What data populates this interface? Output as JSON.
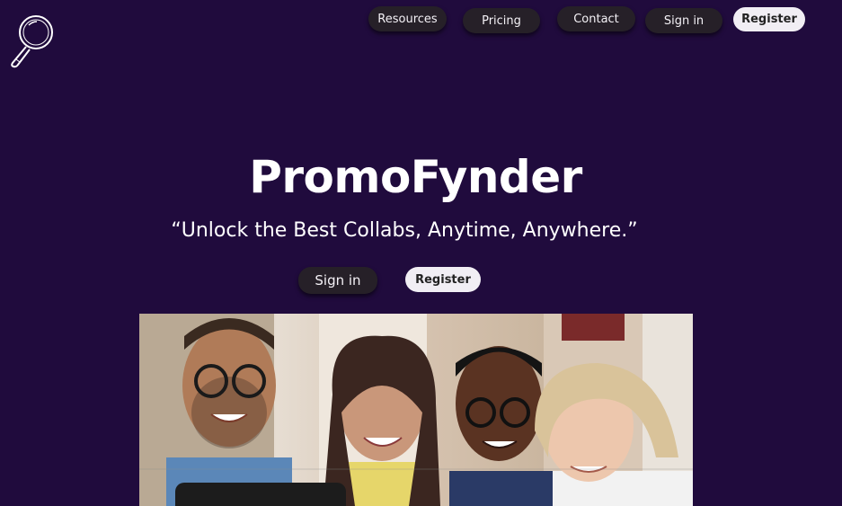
{
  "app": {
    "name": "PromoFynder"
  },
  "nav": {
    "resources": "Resources",
    "pricing": "Pricing",
    "contact": "Contact",
    "sign_in": "Sign in",
    "register": "Register"
  },
  "hero": {
    "title": "PromoFynder",
    "tagline": "“Unlock the Best Collabs, Anytime, Anywhere.”",
    "sign_in": "Sign in",
    "register": "Register"
  },
  "photo": {
    "alt": ""
  },
  "icons": {
    "logo": "magnifying-glass-icon"
  },
  "colors": {
    "background": "#200b3d",
    "dark_button": "#262028",
    "light_button": "#f1eef4"
  }
}
